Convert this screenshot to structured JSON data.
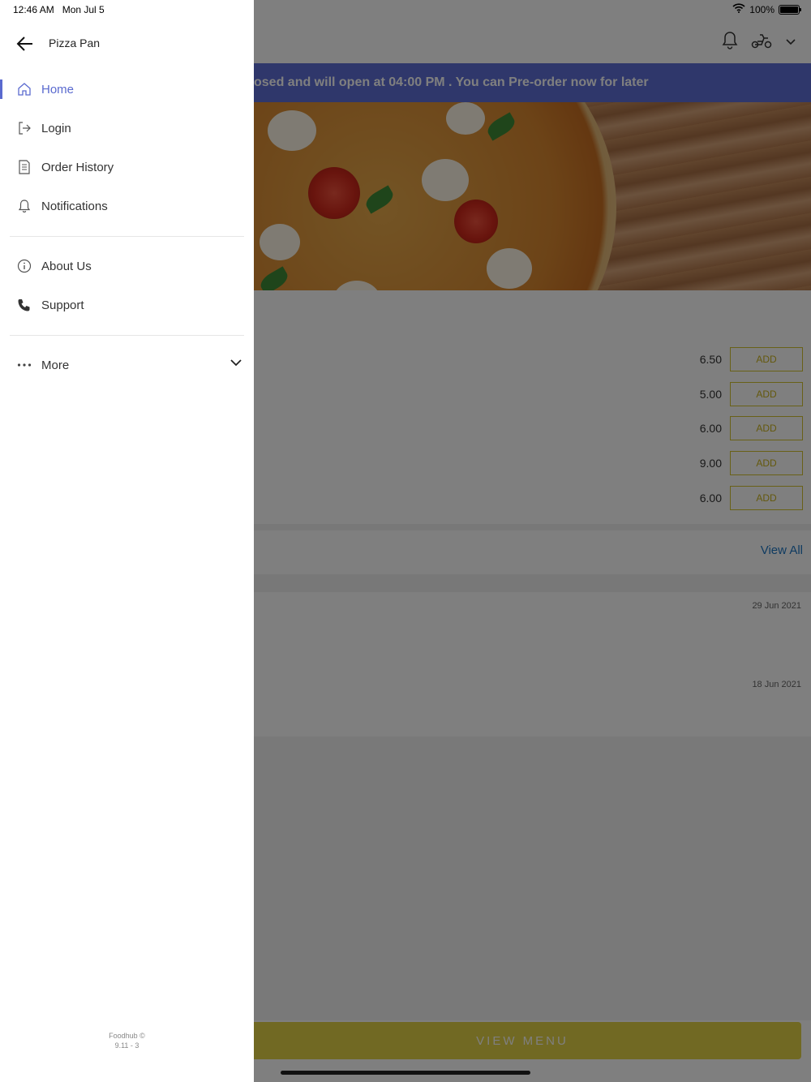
{
  "status_bar": {
    "time": "12:46 AM",
    "date": "Mon Jul 5",
    "battery": "100%",
    "battery_level": 1.0
  },
  "drawer": {
    "title": "Pizza Pan",
    "primary_items": [
      {
        "label": "Home",
        "icon": "home-icon",
        "active": true
      },
      {
        "label": "Login",
        "icon": "login-icon",
        "active": false
      },
      {
        "label": "Order History",
        "icon": "receipt-icon",
        "active": false
      },
      {
        "label": "Notifications",
        "icon": "bell-icon",
        "active": false
      }
    ],
    "secondary_items": [
      {
        "label": "About Us",
        "icon": "info-icon"
      },
      {
        "label": "Support",
        "icon": "phone-icon"
      }
    ],
    "more": {
      "label": "More",
      "icon": "more-dots-icon"
    },
    "footer": {
      "brand": "Foodhub ©",
      "version": "9.11 - 3"
    }
  },
  "background_app": {
    "banner_text": "osed and will open at 04:00 PM . You can Pre-order now for later",
    "menu_items": [
      {
        "price": "6.50",
        "add_label": "ADD"
      },
      {
        "price": "5.00",
        "add_label": "ADD"
      },
      {
        "price": "6.00",
        "add_label": "ADD"
      },
      {
        "price": "9.00",
        "add_label": "ADD"
      },
      {
        "price": "6.00",
        "add_label": "ADD"
      }
    ],
    "view_all": "View All",
    "orders": [
      {
        "date": "29 Jun 2021"
      },
      {
        "date": "18 Jun 2021"
      }
    ],
    "view_menu": "VIEW MENU"
  },
  "colors": {
    "accent": "#5a6acf",
    "banner": "#5e6fd6",
    "add_button": "#d3c22e",
    "view_menu": "#e3d246",
    "link": "#1f77c2"
  }
}
